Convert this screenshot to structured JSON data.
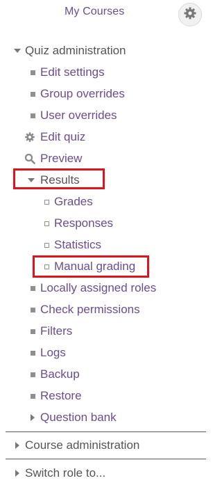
{
  "header": {
    "my_courses_label": "My Courses",
    "settings_icon": "gear-icon"
  },
  "quiz_admin": {
    "label": "Quiz administration",
    "items": [
      {
        "label": "Edit settings",
        "icon": "bullet"
      },
      {
        "label": "Group overrides",
        "icon": "bullet"
      },
      {
        "label": "User overrides",
        "icon": "bullet"
      },
      {
        "label": "Edit quiz",
        "icon": "gear-icon"
      },
      {
        "label": "Preview",
        "icon": "search-icon"
      }
    ],
    "results": {
      "label": "Results",
      "items": [
        {
          "label": "Grades",
          "icon": "square-bullet"
        },
        {
          "label": "Responses",
          "icon": "square-bullet"
        },
        {
          "label": "Statistics",
          "icon": "square-bullet"
        },
        {
          "label": "Manual grading",
          "icon": "square-bullet"
        }
      ]
    },
    "more_items": [
      {
        "label": "Locally assigned roles",
        "icon": "bullet"
      },
      {
        "label": "Check permissions",
        "icon": "bullet"
      },
      {
        "label": "Filters",
        "icon": "bullet"
      },
      {
        "label": "Logs",
        "icon": "bullet"
      },
      {
        "label": "Backup",
        "icon": "bullet"
      },
      {
        "label": "Restore",
        "icon": "bullet"
      }
    ],
    "question_bank": {
      "label": "Question bank",
      "icon": "caret-right-icon"
    }
  },
  "course_admin": {
    "label": "Course administration"
  },
  "switch_role": {
    "label": "Switch role to..."
  },
  "colors": {
    "link": "#6a4c93",
    "text": "#555555",
    "highlight": "#e0131b",
    "gear_bg": "#f1f1f1"
  }
}
